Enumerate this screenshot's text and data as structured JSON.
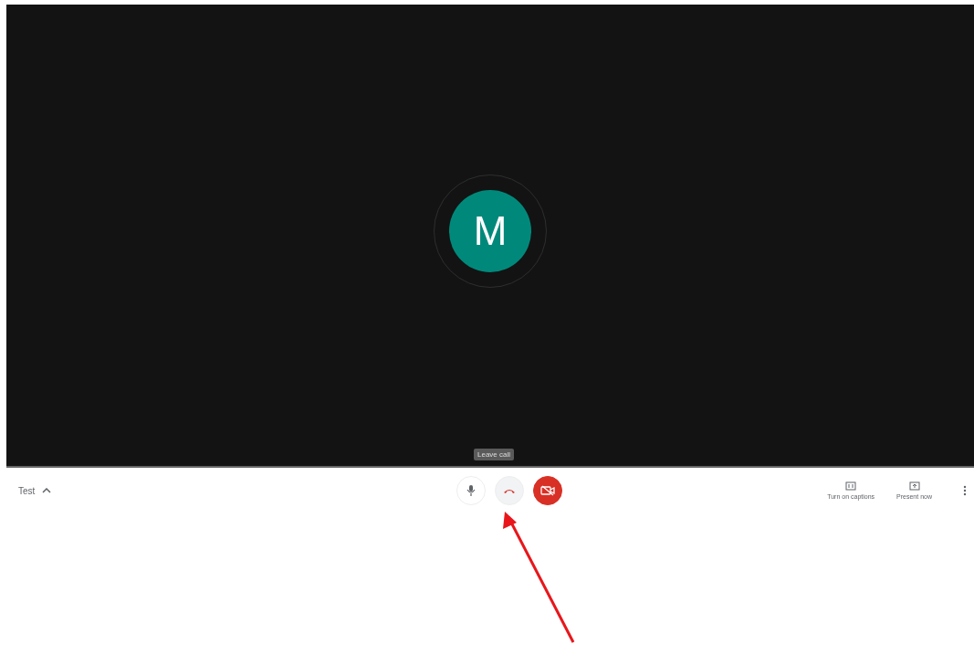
{
  "stage": {
    "avatar": {
      "letter": "M",
      "color": "#00897b"
    },
    "tooltip": "Leave call"
  },
  "bottom_bar": {
    "meeting_name": "Test",
    "expanded": false,
    "controls": [
      {
        "kind": "mic",
        "on": true,
        "hovered": false
      },
      {
        "kind": "leave",
        "hovered": true
      },
      {
        "kind": "camera",
        "on": false,
        "hovered": false
      }
    ],
    "actions": [
      {
        "kind": "captions",
        "label": "Turn on captions"
      },
      {
        "kind": "present",
        "label": "Present now"
      }
    ]
  }
}
